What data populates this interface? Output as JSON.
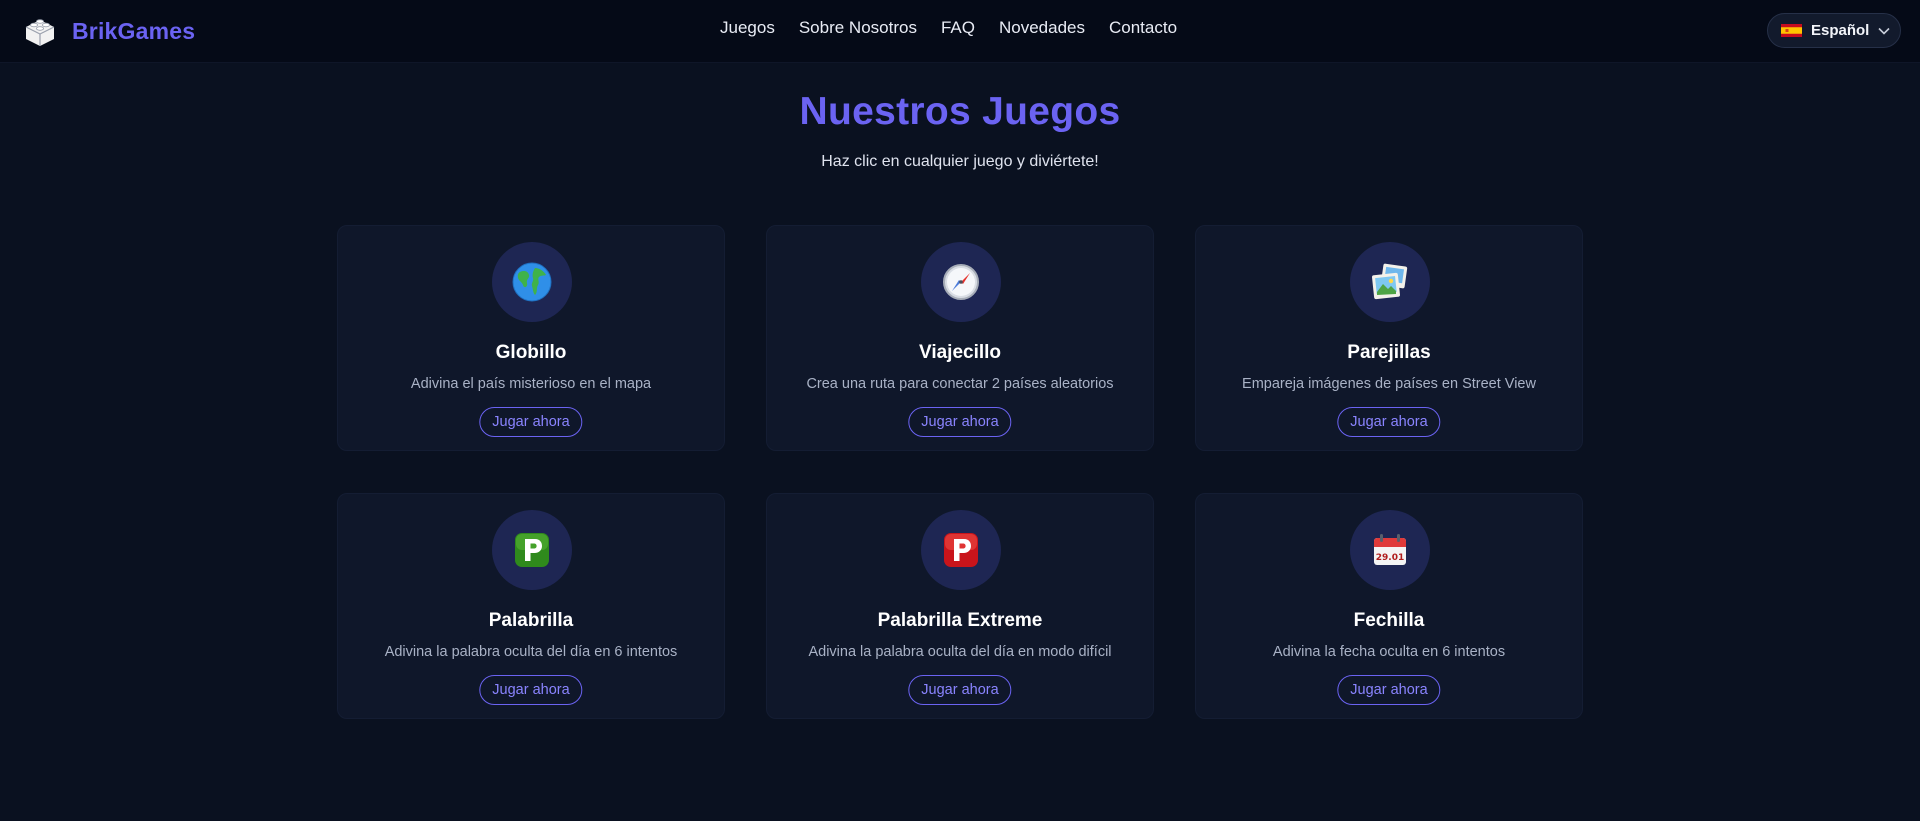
{
  "brand": {
    "name": "BrikGames",
    "icon": "lego-brick-icon"
  },
  "nav": {
    "links": [
      "Juegos",
      "Sobre Nosotros",
      "FAQ",
      "Novedades",
      "Contacto"
    ]
  },
  "language": {
    "selected": "Español",
    "flag": "spain-flag-icon"
  },
  "hero": {
    "title": "Nuestros Juegos",
    "subtitle": "Haz clic en cualquier juego y diviértete!"
  },
  "games": [
    {
      "name": "Globillo",
      "description": "Adivina el país misterioso en el mapa",
      "button": "Jugar ahora",
      "icon": "globe-icon"
    },
    {
      "name": "Viajecillo",
      "description": "Crea una ruta para conectar 2 países aleatorios",
      "button": "Jugar ahora",
      "icon": "compass-icon"
    },
    {
      "name": "Parejillas",
      "description": "Empareja imágenes de países en Street View",
      "button": "Jugar ahora",
      "icon": "pictures-icon"
    },
    {
      "name": "Palabrilla",
      "description": "Adivina la palabra oculta del día en 6 intentos",
      "button": "Jugar ahora",
      "icon": "green-p-icon"
    },
    {
      "name": "Palabrilla Extreme",
      "description": "Adivina la palabra oculta del día en modo difícil",
      "button": "Jugar ahora",
      "icon": "red-p-icon"
    },
    {
      "name": "Fechilla",
      "description": "Adivina la fecha oculta en 6 intentos",
      "button": "Jugar ahora",
      "icon": "calendar-icon",
      "icon_text": "29.01"
    }
  ],
  "colors": {
    "accent": "#6b63f2",
    "background": "#0a1120",
    "navbar": "#050a17",
    "card": "#0f172a",
    "icon_circle": "#1e2653"
  }
}
